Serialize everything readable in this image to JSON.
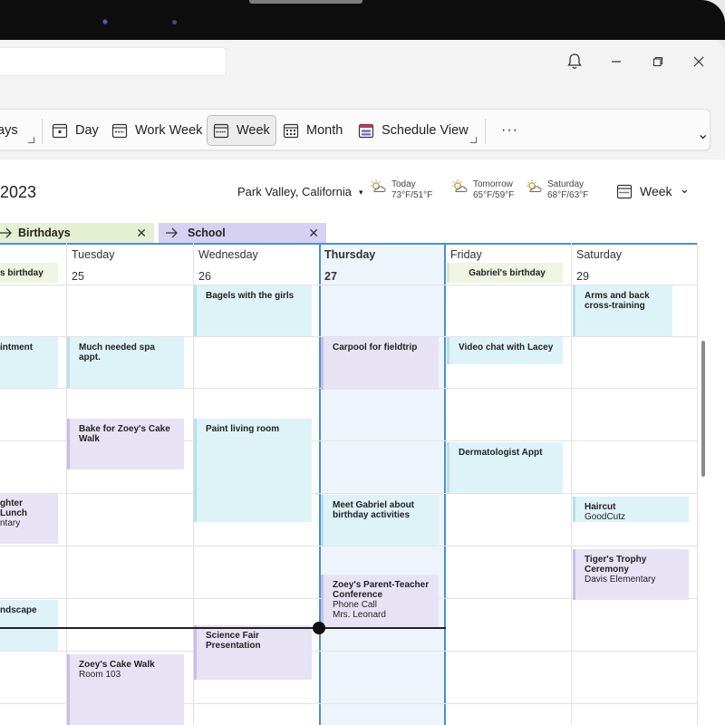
{
  "ribbon": {
    "items": [
      {
        "label": "ays"
      },
      {
        "label": "Day"
      },
      {
        "label": "Work Week"
      },
      {
        "label": "Week"
      },
      {
        "label": "Month"
      },
      {
        "label": "Schedule View"
      }
    ],
    "more": "···",
    "chevron": "⌄"
  },
  "header": {
    "year": "2023",
    "location": "Park Valley, California",
    "location_caret": "▾",
    "weather": [
      {
        "day": "Today",
        "temps": "73°F/51°F"
      },
      {
        "day": "Tomorrow",
        "temps": "65°F/59°F"
      },
      {
        "day": "Saturday",
        "temps": "68°F/63°F"
      }
    ],
    "view": "Week",
    "view_caret": "⌄"
  },
  "chips": [
    {
      "label": "Birthdays",
      "color": "#e3f0d2"
    },
    {
      "label": "School",
      "color": "#d6d1f2"
    }
  ],
  "days": [
    {
      "name": "Tuesday",
      "num": "25"
    },
    {
      "name": "Wednesday",
      "num": "26"
    },
    {
      "name": "Thursday",
      "num": "27"
    },
    {
      "name": "Friday",
      "num": "28"
    },
    {
      "name": "Saturday",
      "num": "29"
    }
  ],
  "events": {
    "mon_birthday": "s birthday",
    "mon_appt": "intment",
    "mon_lunch1": "ghter Lunch",
    "mon_lunch2": "ntary",
    "mon_landscape": "ndscape",
    "tue_spa": "Much needed spa appt.",
    "tue_bake": "Bake for Zoey's Cake Walk",
    "tue_cake1": "Zoey's Cake Walk",
    "tue_cake2": "Room 103",
    "wed_bagels": "Bagels with the girls",
    "wed_paint": "Paint living room",
    "wed_science": "Science Fair Presentation",
    "thu_carpool": "Carpool for fieldtrip",
    "thu_gabriel1": "Meet Gabriel about",
    "thu_gabriel2": "birthday activities",
    "thu_zoey1": "Zoey's Parent-Teacher",
    "thu_zoey2": "Conference",
    "thu_zoey3": "Phone Call",
    "thu_zoey4": "Mrs. Leonard",
    "fri_birthday": "Gabriel's birthday",
    "fri_video": "Video chat with Lacey",
    "fri_derm": "Dermatologist Appt",
    "sat_arms1": "Arms and back",
    "sat_arms2": "cross-training",
    "sat_haircut1": "Haircut",
    "sat_haircut2": "GoodCutz",
    "sat_tiger1": "Tiger's Trophy Ceremony",
    "sat_tiger2": "Davis Elementary"
  },
  "colors": {
    "accent": "#4f8ed1",
    "blue_event": "#def3f7",
    "purple_event": "#e7e3f4",
    "green_event": "#eef5e1"
  }
}
